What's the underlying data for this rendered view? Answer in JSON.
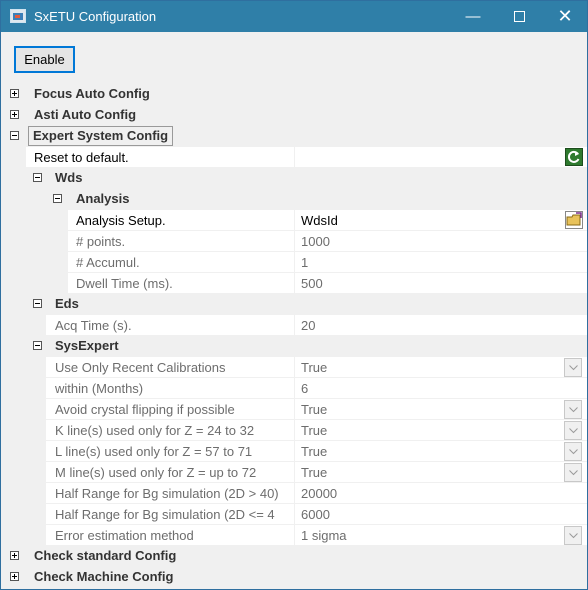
{
  "window": {
    "title": "SxETU Configuration"
  },
  "controls": {
    "enable_label": "Enable",
    "minimize": "—",
    "close": "✕"
  },
  "categories": {
    "focus": "Focus Auto Config",
    "asti": "Asti Auto Config",
    "expert": "Expert System Config",
    "check_standard": "Check standard Config",
    "check_machine": "Check Machine Config"
  },
  "reset": {
    "label": "Reset to default."
  },
  "wds": {
    "label": "Wds",
    "analysis": {
      "label": "Analysis",
      "setup": {
        "label": "Analysis Setup.",
        "value": "WdsId"
      },
      "points": {
        "label": "# points.",
        "value": "1000"
      },
      "accumul": {
        "label": "# Accumul.",
        "value": "1"
      },
      "dwell": {
        "label": "Dwell Time (ms).",
        "value": "500"
      }
    }
  },
  "eds": {
    "label": "Eds",
    "acq": {
      "label": "Acq Time (s).",
      "value": "20"
    }
  },
  "sysexpert": {
    "label": "SysExpert",
    "items": [
      {
        "label": "Use Only Recent Calibrations",
        "value": "True"
      },
      {
        "label": "within (Months)",
        "value": "6"
      },
      {
        "label": "Avoid crystal flipping if possible",
        "value": "True"
      },
      {
        "label": "K line(s) used only for Z = 24 to 32",
        "value": "True"
      },
      {
        "label": "L line(s) used only for Z = 57 to 71",
        "value": "True"
      },
      {
        "label": "M line(s) used only for Z = up to 72",
        "value": "True"
      },
      {
        "label": "Half Range for Bg simulation (2D > 40)",
        "value": "20000"
      },
      {
        "label": "Half Range for Bg simulation (2D <= 4",
        "value": "6000"
      },
      {
        "label": "Error estimation method",
        "value": "1 sigma"
      }
    ]
  },
  "colors": {
    "titlebar": "#2f7fa8",
    "accent": "#0078d7"
  }
}
